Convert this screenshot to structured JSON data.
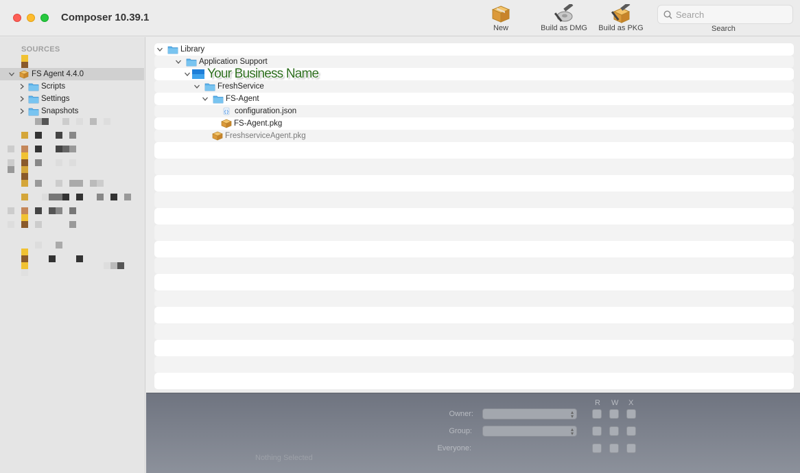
{
  "app": {
    "title": "Composer 10.39.1"
  },
  "toolbar": {
    "new_label": "New",
    "dmg_label": "Build as DMG",
    "pkg_label": "Build as PKG",
    "search_placeholder": "Search",
    "search_label": "Search"
  },
  "sidebar": {
    "header": "SOURCES",
    "package": {
      "label": "FS Agent 4.4.0",
      "icon": "package-icon"
    },
    "children": [
      {
        "label": "Scripts",
        "icon": "folder-icon"
      },
      {
        "label": "Settings",
        "icon": "folder-icon"
      },
      {
        "label": "Snapshots",
        "icon": "folder-icon"
      }
    ]
  },
  "tree": {
    "library": "Library",
    "app_support": "Application Support",
    "business": "Your Business Name",
    "freshservice": "FreshService",
    "fs_agent": "FS-Agent",
    "config_json": "configuration.json",
    "fs_agent_pkg": "FS-Agent.pkg",
    "fs_service_pkg": "FreshserviceAgent.pkg"
  },
  "permissions": {
    "owner_label": "Owner:",
    "group_label": "Group:",
    "everyone_label": "Everyone:",
    "col_r": "R",
    "col_w": "W",
    "col_x": "X",
    "status": "Nothing Selected"
  },
  "colors": {
    "folder": "#5db4ea",
    "package": "#e0a63a",
    "business_text": "#2e6e1f",
    "panel_gray": "#7d828c"
  }
}
